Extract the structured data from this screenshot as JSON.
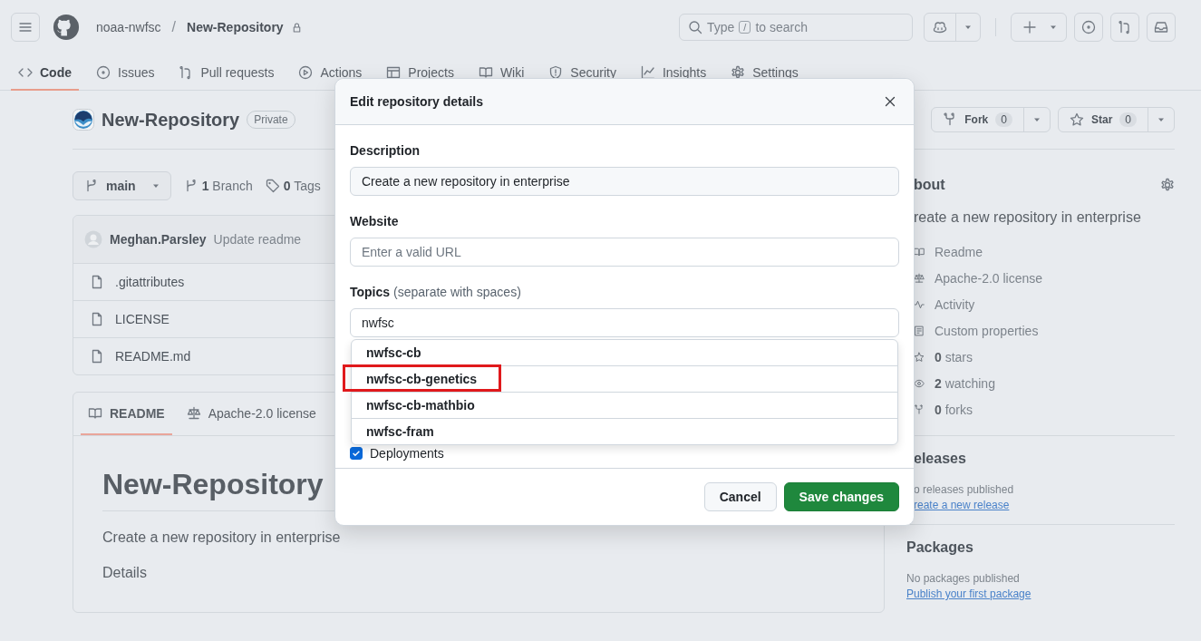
{
  "header": {
    "owner": "noaa-nwfsc",
    "separator": "/",
    "repo": "New-Repository",
    "search": {
      "before": "Type",
      "key": "/",
      "after": "to search"
    }
  },
  "nav_tabs": [
    {
      "label": "Code",
      "kind": "code",
      "selected": true
    },
    {
      "label": "Issues",
      "kind": "issue",
      "selected": false
    },
    {
      "label": "Pull requests",
      "kind": "pr",
      "selected": false
    },
    {
      "label": "Actions",
      "kind": "play",
      "selected": false
    },
    {
      "label": "Projects",
      "kind": "table",
      "selected": false
    },
    {
      "label": "Wiki",
      "kind": "book",
      "selected": false
    },
    {
      "label": "Security",
      "kind": "shield",
      "selected": false
    },
    {
      "label": "Insights",
      "kind": "graph",
      "selected": false
    },
    {
      "label": "Settings",
      "kind": "gear",
      "selected": false
    }
  ],
  "repo": {
    "name": "New-Repository",
    "visibility": "Private",
    "fork": {
      "label": "Fork",
      "count": "0"
    },
    "star": {
      "label": "Star",
      "count": "0"
    }
  },
  "branch": {
    "name": "main",
    "branches": "**1** Branch",
    "tags": "**0** Tags"
  },
  "latest_commit": {
    "author": "Meghan.Parsley",
    "message": "Update readme"
  },
  "files": [
    {
      "name": ".gitattributes"
    },
    {
      "name": "LICENSE"
    },
    {
      "name": "README.md"
    }
  ],
  "readme": {
    "tabs": [
      {
        "label": "README",
        "kind": "book",
        "selected": true
      },
      {
        "label": "Apache-2.0 license",
        "kind": "law",
        "selected": false
      }
    ],
    "heading": "New-Repository",
    "paragraphs": [
      "Create a new repository in enterprise",
      "Details"
    ]
  },
  "about": {
    "heading": "bout",
    "description": "reate a new repository in enterprise",
    "items": [
      {
        "kind": "book",
        "label": "Readme"
      },
      {
        "kind": "law",
        "label": "Apache-2.0 license"
      },
      {
        "kind": "pulse",
        "label": "Activity"
      },
      {
        "kind": "note",
        "label": "Custom properties"
      },
      {
        "kind": "star",
        "label": "**0** stars"
      },
      {
        "kind": "eye",
        "label": "**2** watching"
      },
      {
        "kind": "fork",
        "label": "**0** forks"
      }
    ]
  },
  "releases": {
    "heading": "eleases",
    "note": "o releases published",
    "link": "reate a new release"
  },
  "packages": {
    "heading": "Packages",
    "note": "No packages published",
    "link": "Publish your first package"
  },
  "dialog": {
    "title": "Edit repository details",
    "description": {
      "label": "Description",
      "value": "Create a new repository in enterprise"
    },
    "website": {
      "label": "Website",
      "placeholder": "Enter a valid URL"
    },
    "topics": {
      "label": "Topics",
      "hint": "(separate with spaces)",
      "value": "nwfsc",
      "suggestions": [
        {
          "label": "nwfsc-cb",
          "highlighted": false
        },
        {
          "label": "nwfsc-cb-genetics",
          "highlighted": true
        },
        {
          "label": "nwfsc-cb-mathbio",
          "highlighted": false
        },
        {
          "label": "nwfsc-fram",
          "highlighted": false
        }
      ]
    },
    "options": [
      {
        "label": "Deployments",
        "checked": true
      }
    ],
    "cancel": "Cancel",
    "save": "Save changes"
  }
}
